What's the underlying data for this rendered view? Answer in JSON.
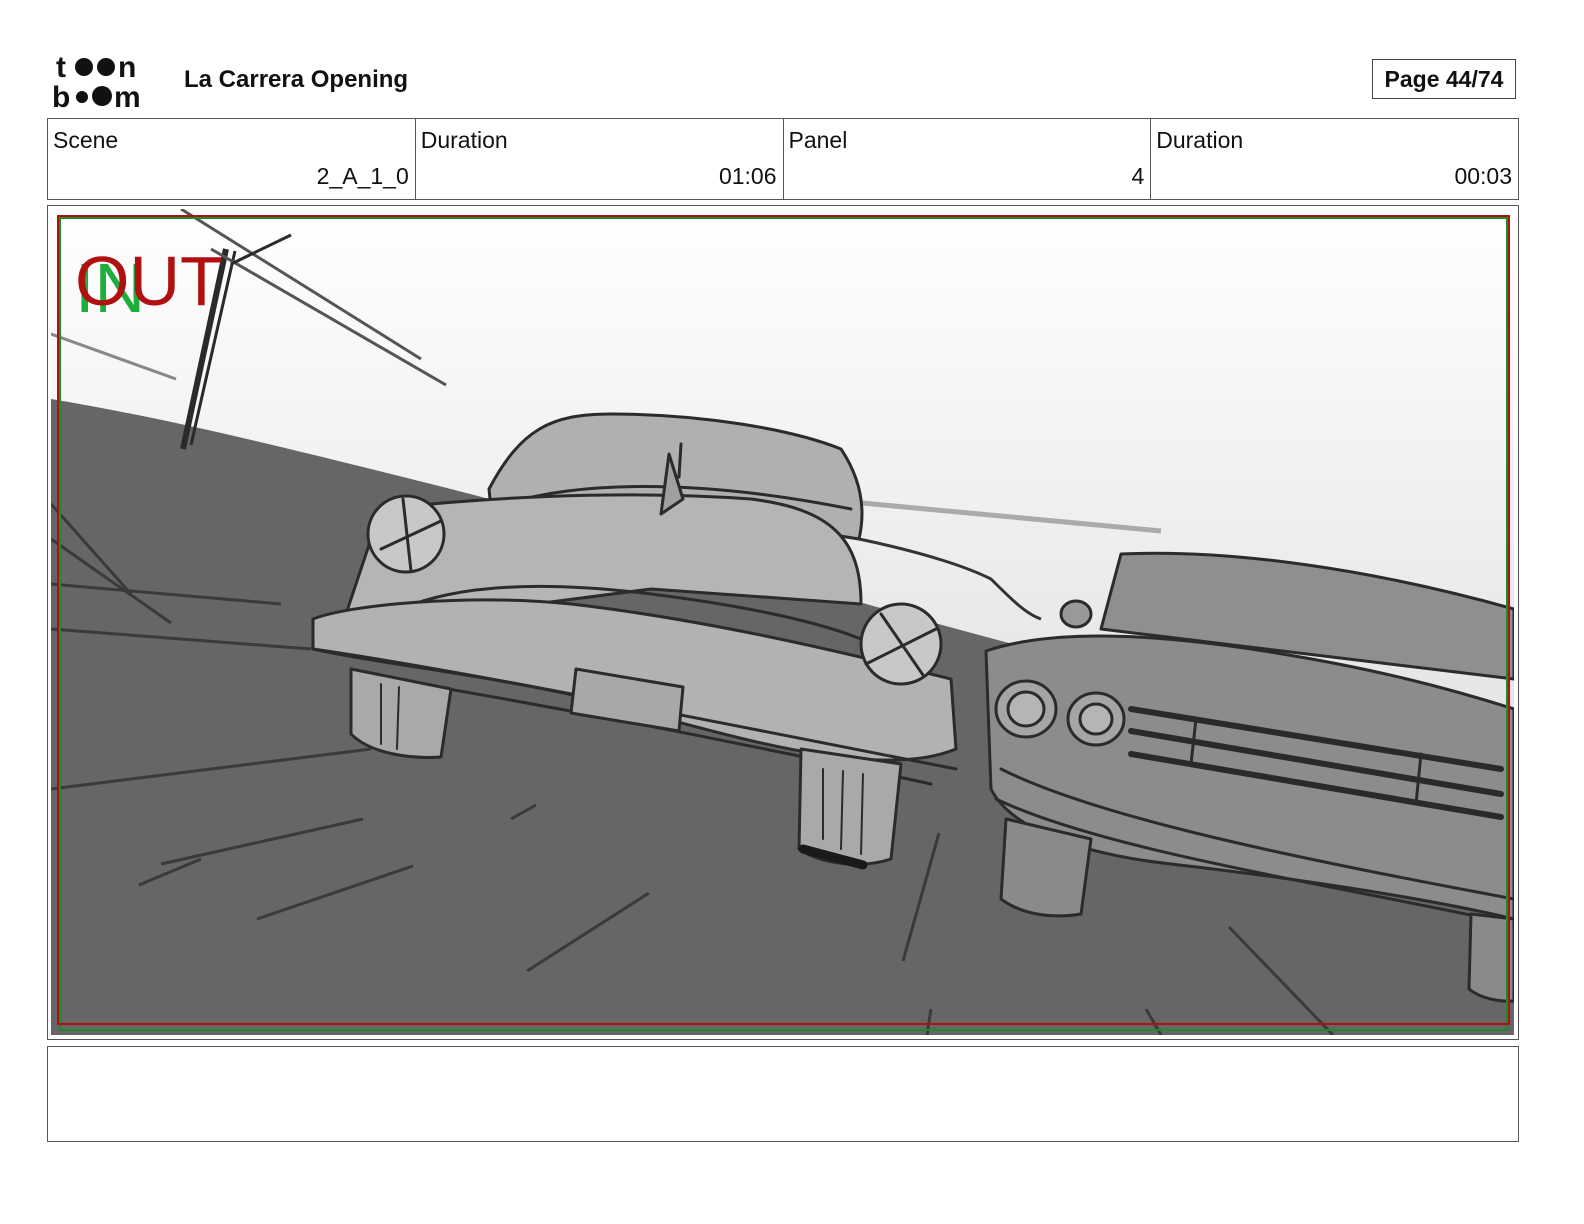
{
  "header": {
    "logo_top": "toon",
    "logo_bottom": "boom",
    "title": "La Carrera Opening",
    "page": "Page 44/74"
  },
  "info": {
    "scene_label": "Scene",
    "scene_value": "2_A_1_0",
    "scene_duration_label": "Duration",
    "scene_duration_value": "01:06",
    "panel_label": "Panel",
    "panel_value": "4",
    "panel_duration_label": "Duration",
    "panel_duration_value": "00:03"
  },
  "panel": {
    "in_marker": "IN",
    "out_marker": "OUT",
    "in_color": "#1fae3c",
    "out_color": "#b01010"
  },
  "notes": {
    "text": ""
  }
}
